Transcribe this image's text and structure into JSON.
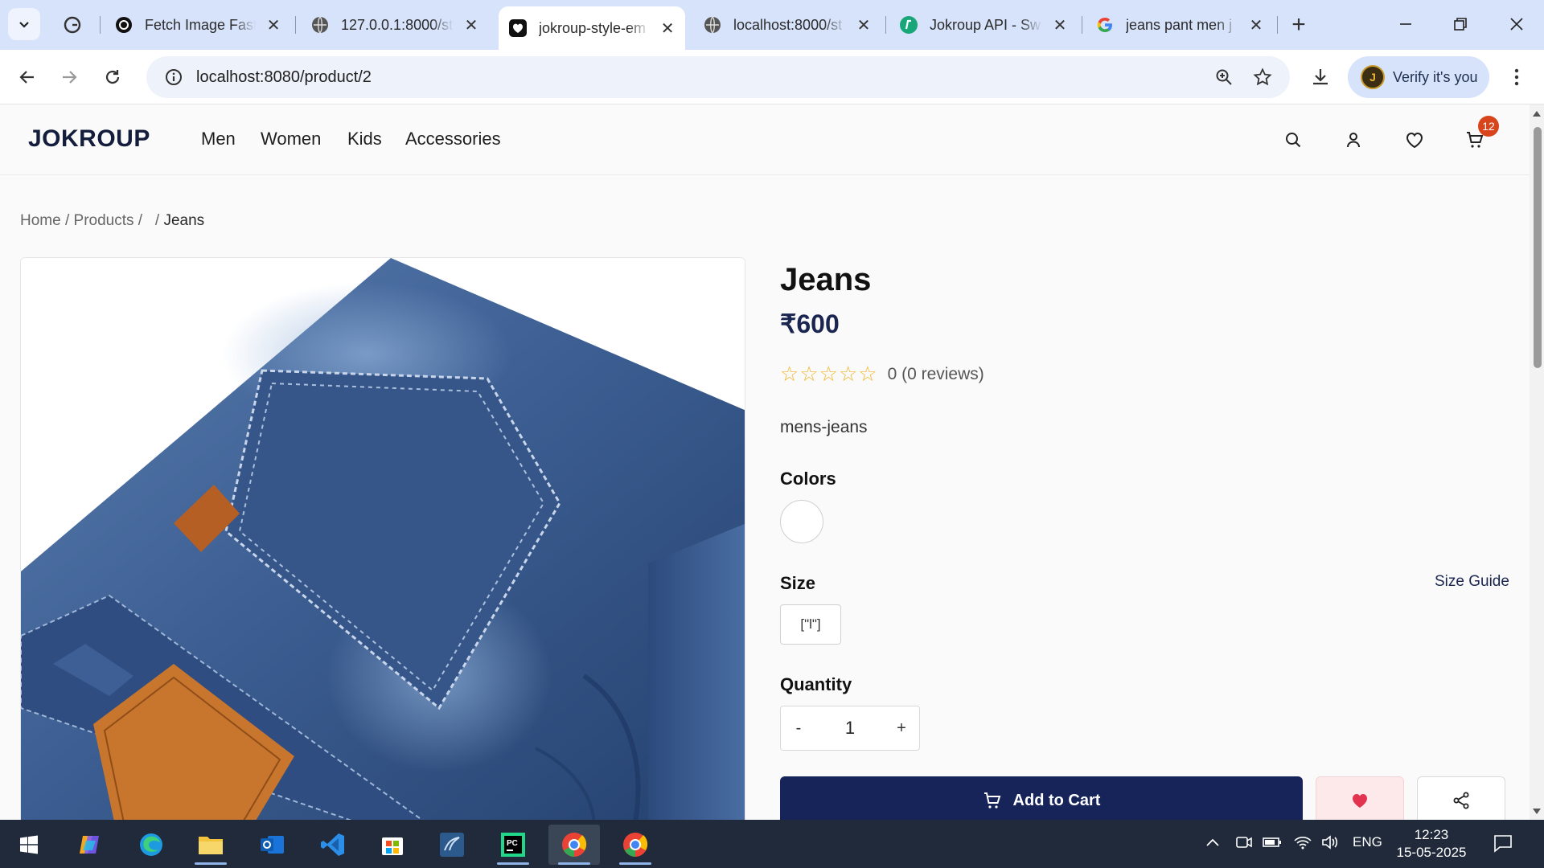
{
  "browser": {
    "tabs": [
      {
        "title": "",
        "favicon": "grammarly-icon"
      },
      {
        "title": "Fetch Image Fast/",
        "favicon": "openai-icon"
      },
      {
        "title": "127.0.0.1:8000/st",
        "favicon": "globe-icon"
      },
      {
        "title": "jokroup-style-em",
        "favicon": "heart-icon",
        "active": true
      },
      {
        "title": "localhost:8000/st",
        "favicon": "globe-icon"
      },
      {
        "title": "Jokroup API - Sw",
        "favicon": "swagger-icon"
      },
      {
        "title": "jeans pant men j",
        "favicon": "google-icon"
      }
    ],
    "url": "localhost:8080/product/2",
    "verify_label": "Verify it's you"
  },
  "site": {
    "logo": "JOKROUP",
    "nav": [
      "Men",
      "Women",
      "Kids",
      "Accessories"
    ],
    "cart_count": "12"
  },
  "breadcrumb": {
    "home": "Home",
    "sep1": " / ",
    "products": "Products",
    "sep2": " /  ",
    "sep3": " / ",
    "current": "Jeans"
  },
  "product": {
    "title": "Jeans",
    "price": "₹600",
    "rating_stars": 0,
    "rating_text": "0 (0 reviews)",
    "category": "mens-jeans",
    "colors_label": "Colors",
    "colors": [
      "#ffffff"
    ],
    "size_label": "Size",
    "size_guide": "Size Guide",
    "sizes": [
      "[\"l\"]"
    ],
    "quantity_label": "Quantity",
    "quantity": "1",
    "minus": "-",
    "plus": "+",
    "add_to_cart": "Add to Cart",
    "accent": "#16245a"
  },
  "taskbar": {
    "lang": "ENG",
    "time": "12:23",
    "date": "15-05-2025"
  }
}
